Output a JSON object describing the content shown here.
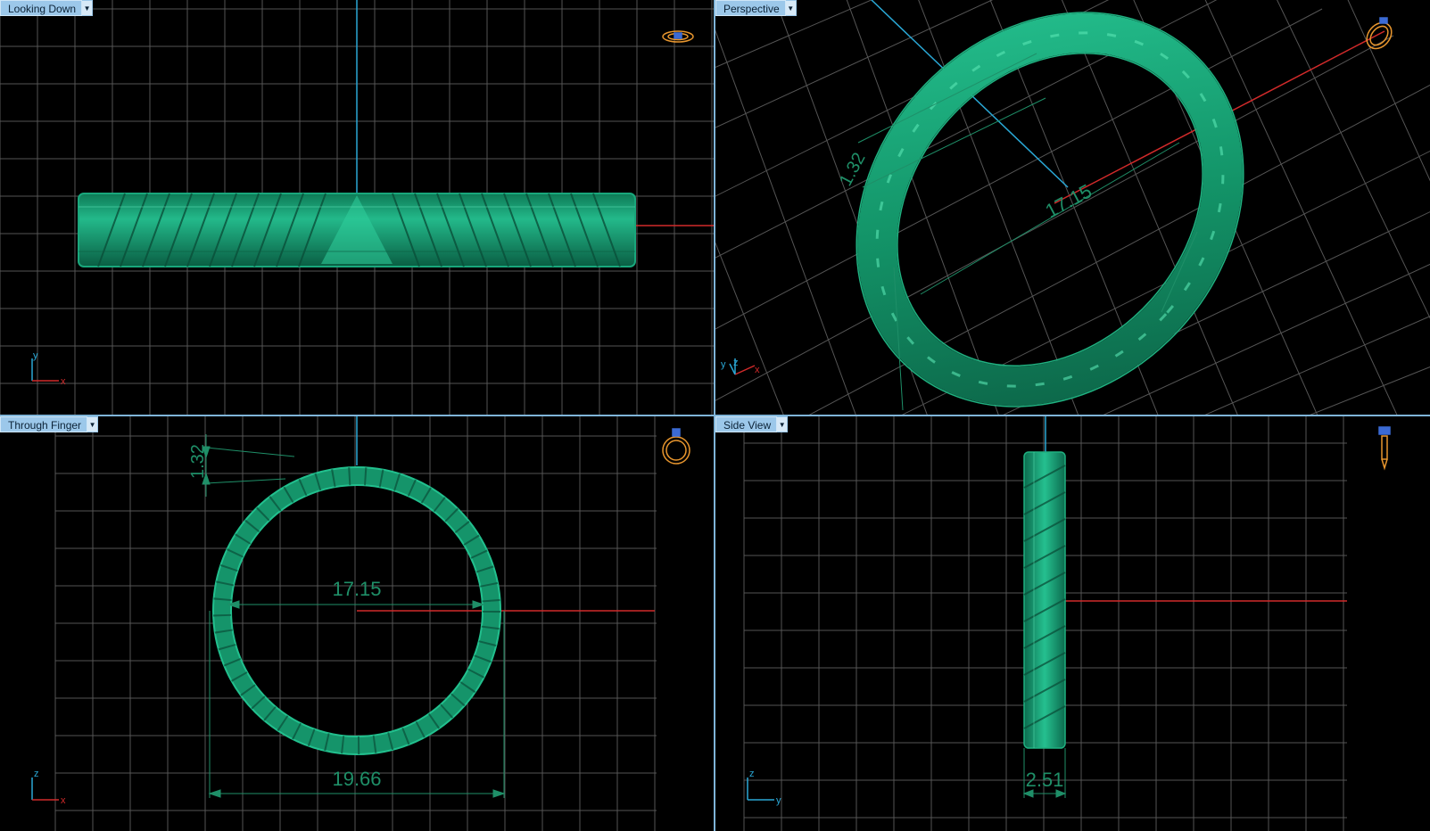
{
  "viewports": {
    "top_left": {
      "label": "Looking Down",
      "axes": {
        "h": "x",
        "v": "y"
      }
    },
    "top_right": {
      "label": "Perspective",
      "axes": {
        "h": "x",
        "v": "y",
        "z": "z"
      },
      "dimensions": {
        "diameter": "17.15",
        "thickness": "1.32"
      }
    },
    "bottom_left": {
      "label": "Through Finger",
      "axes": {
        "h": "x",
        "v": "z"
      },
      "dimensions": {
        "thickness": "1.32",
        "inner_diameter": "17.15",
        "outer_diameter": "19.66"
      }
    },
    "bottom_right": {
      "label": "Side View",
      "axes": {
        "h": "y",
        "v": "z"
      },
      "dimensions": {
        "width": "2.51"
      }
    }
  },
  "icons": {
    "dropdown": "chevron-down-icon",
    "ring_top": "ring-top-orientation-icon",
    "ring_persp": "ring-perspective-orientation-icon",
    "ring_front": "ring-front-orientation-icon",
    "ring_side": "ring-side-orientation-icon"
  },
  "colors": {
    "background": "#000000",
    "grid": "#5a5a5a",
    "model": "#1aa37a",
    "model_dark": "#0c6b4e",
    "dimension": "#1f8f68",
    "axis_x": "#d12a2a",
    "axis_y": "#2aa8d6",
    "label_bg": "#9cc8ea",
    "icon": "#e8962e"
  }
}
